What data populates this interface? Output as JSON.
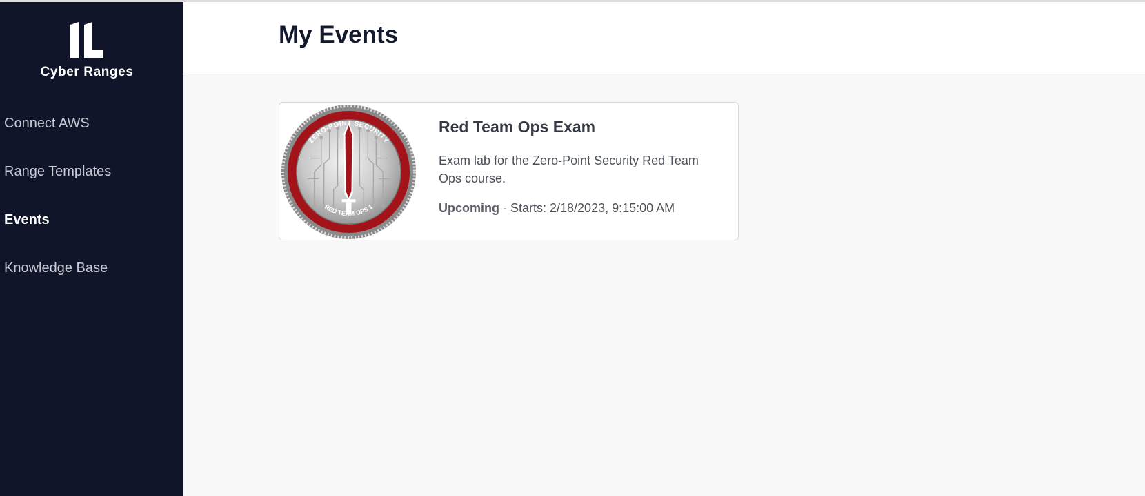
{
  "brand": {
    "name": "Cyber Ranges",
    "logo_icon": "il-logo-icon"
  },
  "sidebar": {
    "items": [
      {
        "label": "Connect AWS",
        "active": false
      },
      {
        "label": "Range Templates",
        "active": false
      },
      {
        "label": "Events",
        "active": true
      },
      {
        "label": "Knowledge Base",
        "active": false
      }
    ]
  },
  "page": {
    "title": "My Events"
  },
  "events": [
    {
      "title": "Red Team Ops Exam",
      "description": "Exam lab for the Zero-Point Security Red Team Ops course.",
      "status": "Upcoming",
      "separator": " - ",
      "starts": "Starts: 2/18/2023, 9:15:00 AM",
      "badge": {
        "icon": "red-team-ops-coin-icon",
        "top_text": "ZERO-POINT SECURITY",
        "bottom_text": "RED TEAM OPS 1"
      }
    }
  ],
  "colors": {
    "sidebar_bg": "#11152a",
    "content_bg": "#f8f8f8",
    "coin_red": "#a3141a",
    "title_text": "#141a2e"
  }
}
